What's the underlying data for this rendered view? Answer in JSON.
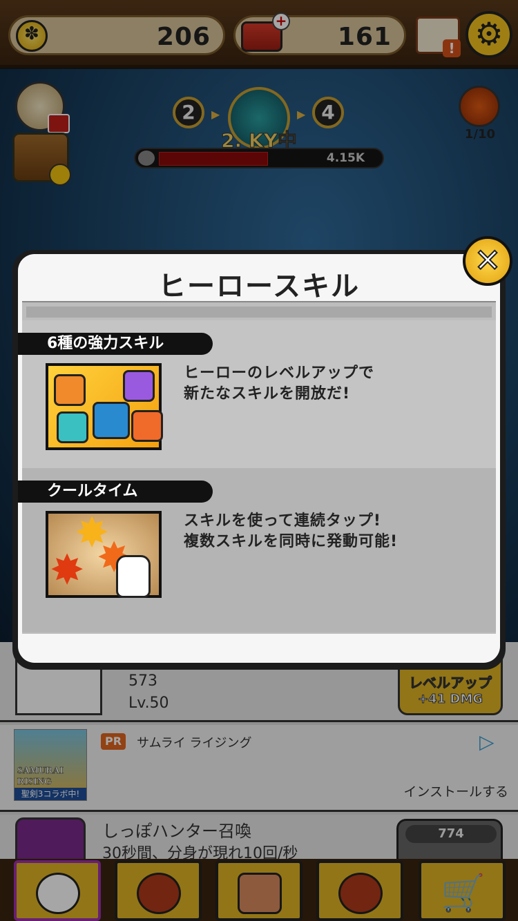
{
  "currency": {
    "coins": "206",
    "cans": "161"
  },
  "stage": {
    "prev": "2",
    "next": "4",
    "label": "2. KY中",
    "hp_text": "4.15K",
    "hp_fraction": 0.55,
    "demon_count": "1/10"
  },
  "hero_row": {
    "value": "573",
    "level": "Lv.50",
    "level_up_line1": "レベルアップ",
    "level_up_line2": "+41 DMG"
  },
  "ad_row": {
    "badge": "PR",
    "title": "サムライ ライジング",
    "install": "インストールする",
    "thumb_brand": "SAMURAI RISING",
    "thumb_caption": "聖剣3コラボ中!"
  },
  "skill_row": {
    "name": "しっぽハンター召喚",
    "desc": "30秒間、分身が現れ10回/秒",
    "cost": "774"
  },
  "modal": {
    "title": "ヒーロースキル",
    "sections": [
      {
        "label": "6種の強力スキル",
        "line1": "ヒーローのレベルアップで",
        "line2": "新たなスキルを開放だ!"
      },
      {
        "label": "クールタイム",
        "line1": "スキルを使って連続タップ!",
        "line2": "複数スキルを同時に発動可能!"
      }
    ]
  },
  "icons": {
    "close": "close-icon",
    "settings": "gear-icon",
    "coin": "paw-coin-icon",
    "can": "cat-food-can-icon"
  }
}
